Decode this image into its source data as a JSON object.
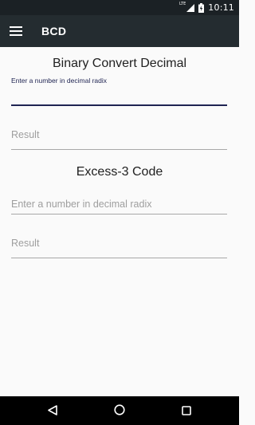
{
  "status_bar": {
    "network_label": "LTE",
    "time": "10:11",
    "icons": [
      "signal-icon",
      "battery-charging-icon"
    ]
  },
  "app_bar": {
    "title": "BCD",
    "menu_icon": "hamburger-menu-icon"
  },
  "binary_section": {
    "title": "Binary Convert Decimal",
    "input": {
      "floating_label": "Enter a number in decimal radix",
      "value": "",
      "focused": true
    },
    "result": {
      "placeholder": "Result",
      "value": ""
    }
  },
  "excess_section": {
    "title": "Excess-3 Code",
    "input": {
      "placeholder": "Enter a number in decimal radix",
      "value": ""
    },
    "result": {
      "placeholder": "Result",
      "value": ""
    }
  },
  "nav_bar": {
    "buttons": [
      "back-icon",
      "home-icon",
      "recents-icon"
    ]
  },
  "colors": {
    "status_bar": "#1b2125",
    "app_bar": "#242c30",
    "background": "#fafafa",
    "focus_accent": "#1f2452",
    "underline": "#a8a8a8",
    "nav_bar": "#000000"
  }
}
